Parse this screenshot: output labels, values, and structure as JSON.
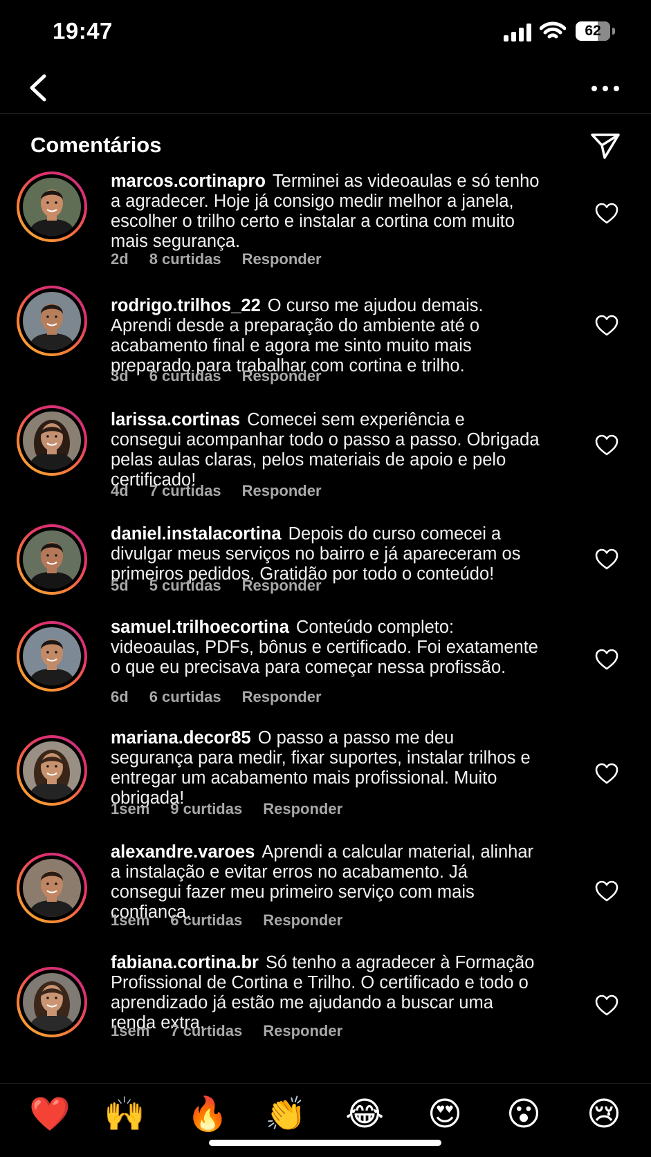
{
  "status_bar": {
    "time": "19:47",
    "battery": "62",
    "battery_level": 0.62
  },
  "header": {
    "title": "Comentários"
  },
  "icons": {
    "back": "chevron-left-icon",
    "more": "more-horizontal-icon",
    "share": "send-icon",
    "like": "heart-outline-icon"
  },
  "colors": {
    "background": "#000000",
    "text": "#ffffff",
    "meta": "#a8a8a8",
    "ring_start": "#f7b733",
    "ring_end": "#c13584"
  },
  "comments": [
    {
      "user": "marcos.cortinapro",
      "text": "Terminei as videoaulas e só tenho a agradecer. Hoje já consigo medir melhor a janela, escolher o trilho certo e instalar a cortina com muito mais segurança.",
      "time": "2d",
      "likes": "8 curtidas",
      "reply": "Responder"
    },
    {
      "user": "rodrigo.trilhos_22",
      "text": "O curso me ajudou demais. Aprendi desde a preparação do ambiente até o acabamento final e agora me sinto muito mais preparado para trabalhar com cortina e trilho.",
      "time": "3d",
      "likes": "6 curtidas",
      "reply": "Responder"
    },
    {
      "user": "larissa.cortinas",
      "text": "Comecei sem experiência e consegui acompanhar todo o passo a passo. Obrigada pelas aulas claras, pelos materiais de apoio e pelo certificado!",
      "time": "4d",
      "likes": "7 curtidas",
      "reply": "Responder"
    },
    {
      "user": "daniel.instalacortina",
      "text": "Depois do curso comecei a divulgar meus serviços no bairro e já apareceram os primeiros pedidos. Gratidão por todo o conteúdo!",
      "time": "5d",
      "likes": "5 curtidas",
      "reply": "Responder"
    },
    {
      "user": "samuel.trilhoecortina",
      "text": "Conteúdo completo: videoaulas, PDFs, bônus e certificado. Foi exatamente o que eu precisava para começar nessa profissão.",
      "time": "6d",
      "likes": "6 curtidas",
      "reply": "Responder"
    },
    {
      "user": "mariana.decor85",
      "text": "O passo a passo me deu segurança para medir, fixar suportes, instalar trilhos e entregar um acabamento mais profissional. Muito obrigada!",
      "time": "1sem",
      "likes": "9 curtidas",
      "reply": "Responder"
    },
    {
      "user": "alexandre.varoes",
      "text": "Aprendi a calcular material, alinhar a instalação e evitar erros no acabamento. Já consegui fazer meu primeiro serviço com mais confiança.",
      "time": "1sem",
      "likes": "6 curtidas",
      "reply": "Responder"
    },
    {
      "user": "fabiana.cortina.br",
      "text": "Só tenho a agradecer à Formação Profissional de Cortina e Trilho. O certificado e todo o aprendizado já estão me ajudando a buscar uma renda extra.",
      "time": "1sem",
      "likes": "7 curtidas",
      "reply": "Responder"
    }
  ],
  "reactions": [
    "❤️",
    "🙌",
    "🔥",
    "👏",
    "😂",
    "😍",
    "😮",
    "😢"
  ]
}
